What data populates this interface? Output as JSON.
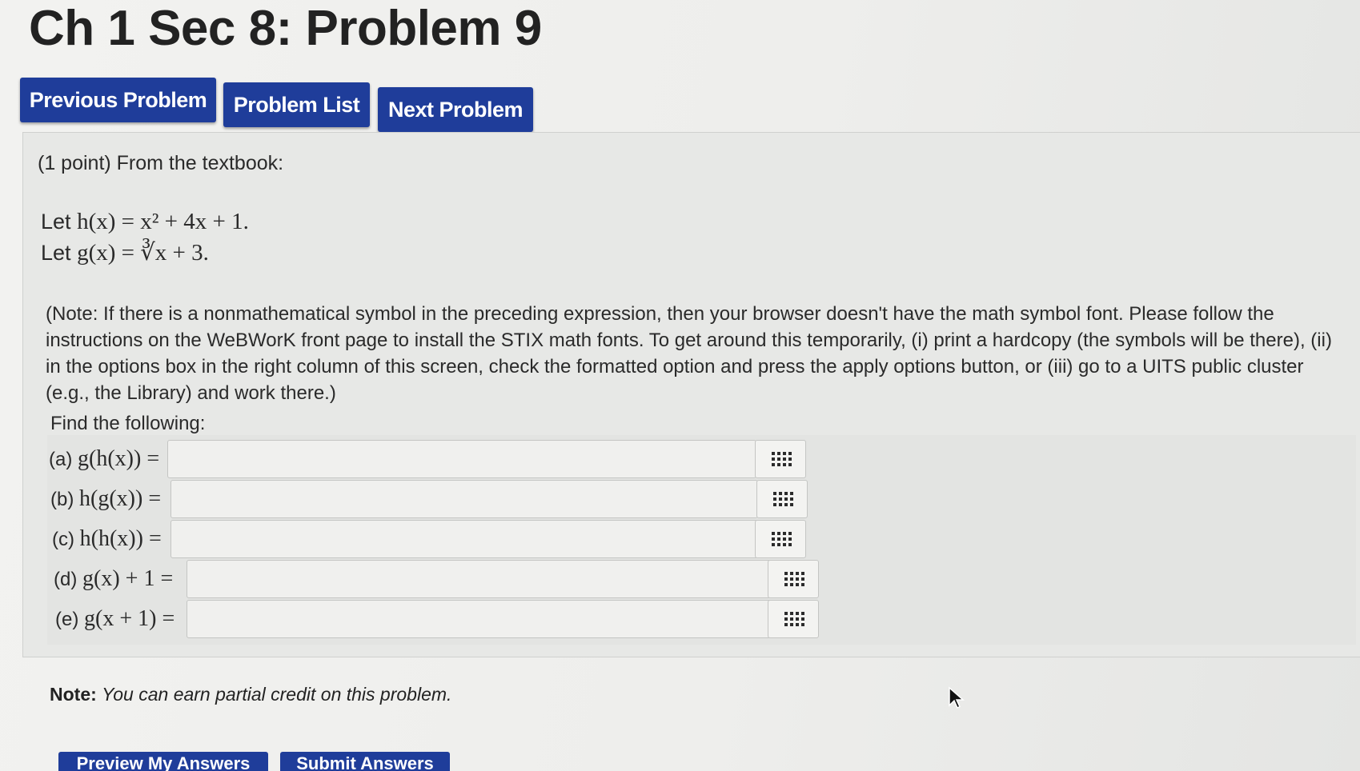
{
  "page": {
    "title": "Ch 1 Sec 8: Problem 9"
  },
  "nav": {
    "previous": "Previous Problem",
    "list": "Problem List",
    "next": "Next Problem"
  },
  "problem": {
    "header": "(1 point) From the textbook:",
    "def1_prefix": "Let",
    "def1_math": "h(x) = x² + 4x + 1.",
    "def2_prefix": "Let",
    "def2_math": "g(x) = ∛x + 3.",
    "note": "(Note: If there is a nonmathematical symbol in the preceding expression, then your browser doesn't have the math symbol font. Please follow the instructions on the WeBWorK front page to install the STIX math fonts. To get around this temporarily, (i) print a hardcopy (the symbols will be there), (ii) in the options box in the right column of this screen, check the formatted option and press the apply options button, or (iii) go to a UITS public cluster (e.g., the Library) and work there.)",
    "find": "Find the following:",
    "answers": [
      {
        "part": "(a)",
        "expr": "g(h(x)) =",
        "value": ""
      },
      {
        "part": "(b)",
        "expr": "h(g(x)) =",
        "value": ""
      },
      {
        "part": "(c)",
        "expr": "h(h(x)) =",
        "value": ""
      },
      {
        "part": "(d)",
        "expr": "g(x) + 1 =",
        "value": ""
      },
      {
        "part": "(e)",
        "expr": "g(x + 1) =",
        "value": ""
      }
    ]
  },
  "footer": {
    "note_label": "Note:",
    "note_text": "You can earn partial credit on this problem.",
    "preview_button": "Preview My Answers",
    "submit_button": "Submit Answers"
  },
  "icons": {
    "equation_editor": "grid-icon",
    "mouse_pointer": "cursor-arrow-icon"
  },
  "colors": {
    "nav_button": "#1f3d9a",
    "background": "#ebecea"
  }
}
